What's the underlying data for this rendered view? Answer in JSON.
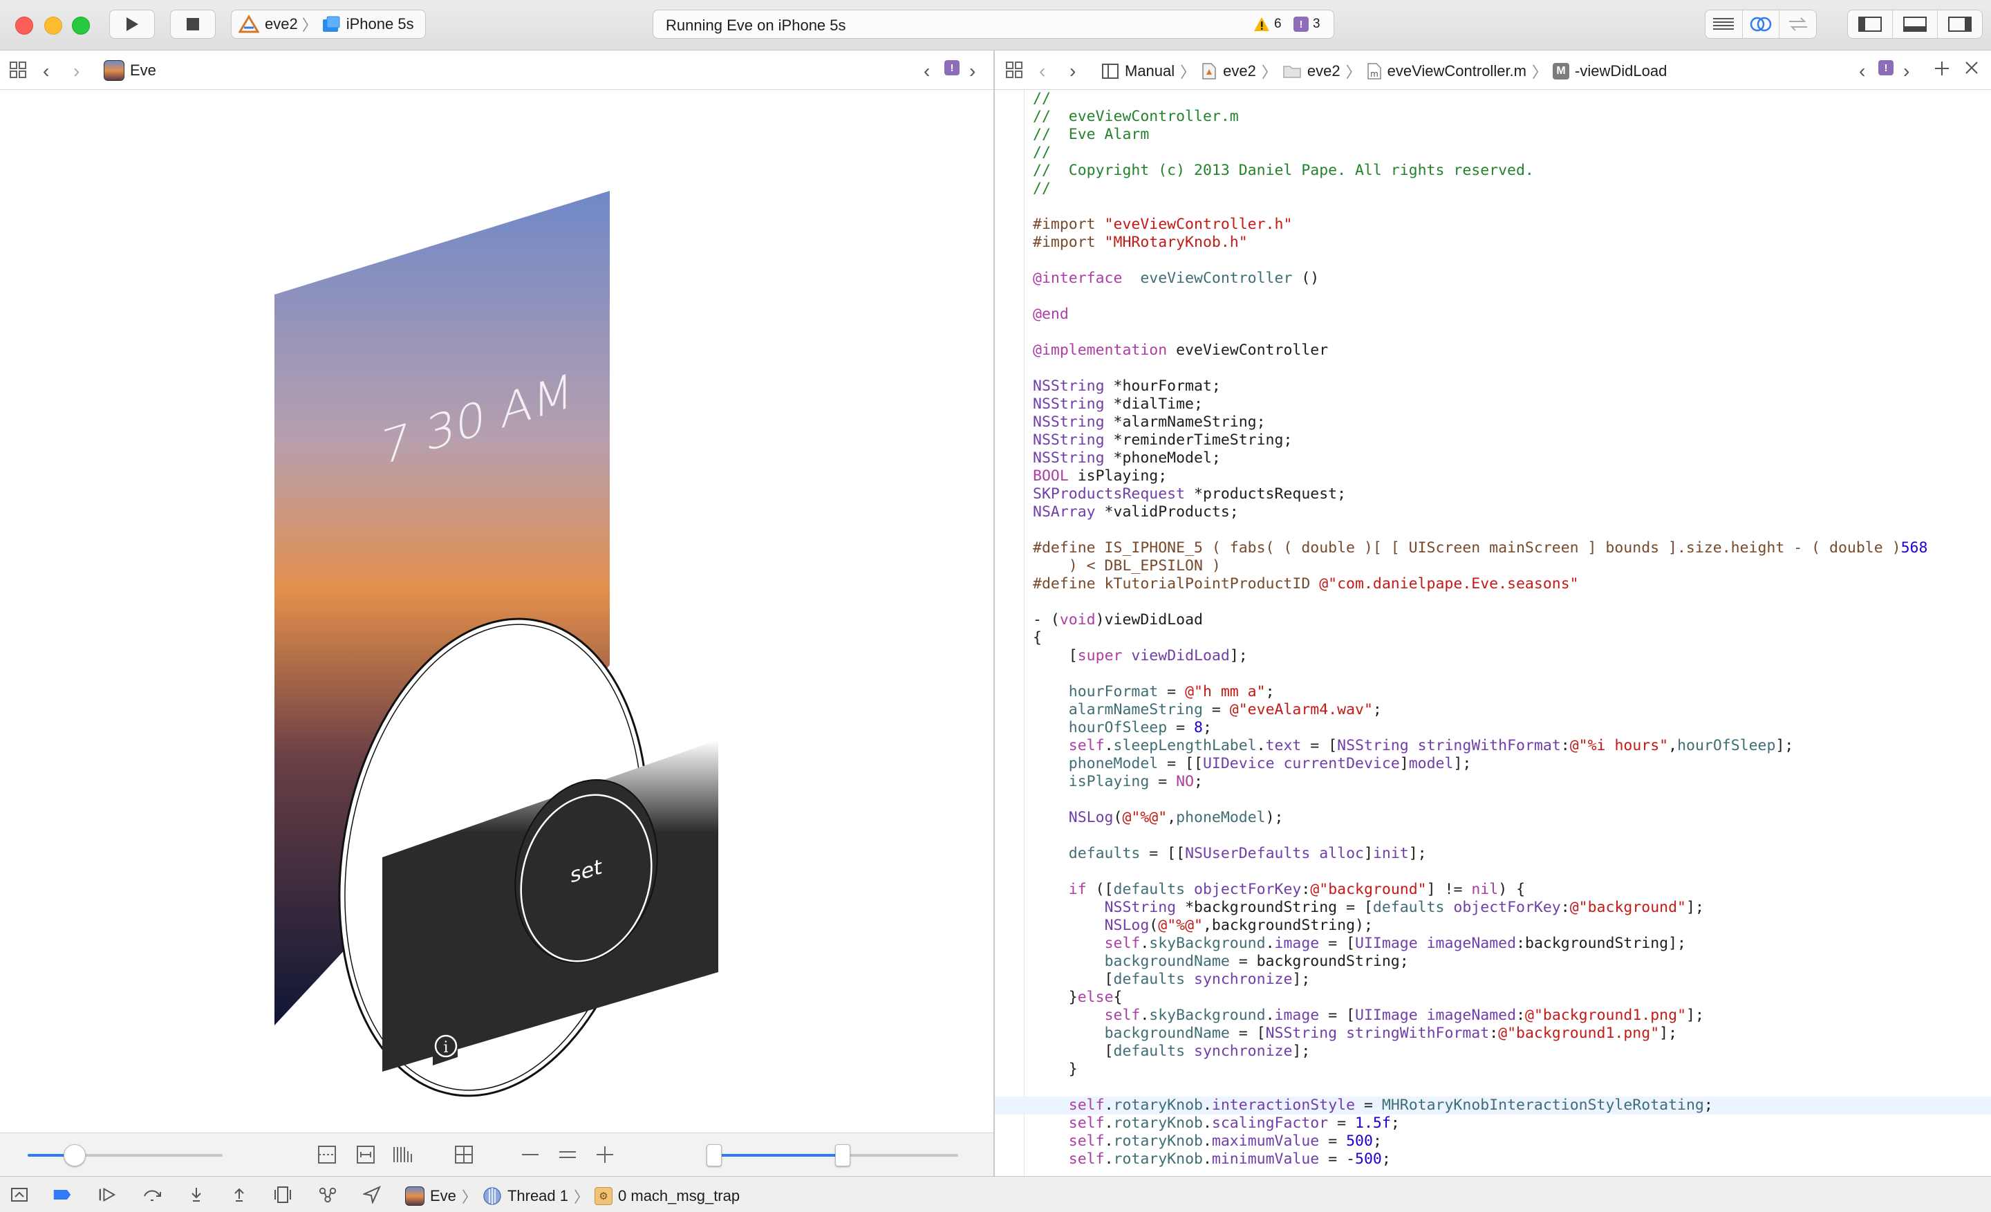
{
  "toolbar": {
    "scheme_target": "eve2",
    "scheme_device": "iPhone 5s",
    "activity_message": "Running Eve on iPhone 5s",
    "warning_count": "6",
    "error_count": "3"
  },
  "left_jumpbar": {
    "app_name": "Eve"
  },
  "right_jumpbar": {
    "crumbs": [
      "Manual",
      "eve2",
      "eve2",
      "eveViewController.m",
      "-viewDidLoad"
    ]
  },
  "scene": {
    "time_label": "7 30 AM",
    "set_label": "set",
    "info_glyph": "i",
    "gradient_colors": [
      "#6f88c8",
      "#e38f4b",
      "#5b3a4a",
      "#0e1735"
    ]
  },
  "debug_bar": {
    "process": "Eve",
    "thread": "Thread 1",
    "frame": "0 mach_msg_trap"
  },
  "editor": {
    "lines": [
      {
        "segs": [
          [
            "c",
            "//"
          ]
        ]
      },
      {
        "segs": [
          [
            "c",
            "//  eveViewController.m"
          ]
        ]
      },
      {
        "segs": [
          [
            "c",
            "//  Eve Alarm"
          ]
        ]
      },
      {
        "segs": [
          [
            "c",
            "//"
          ]
        ]
      },
      {
        "segs": [
          [
            "c",
            "//  Copyright (c) 2013 Daniel Pape. All rights reserved."
          ]
        ]
      },
      {
        "segs": [
          [
            "c",
            "//"
          ]
        ]
      },
      {
        "segs": []
      },
      {
        "segs": [
          [
            "p",
            "#import "
          ],
          [
            "s",
            "\"eveViewController.h\""
          ]
        ]
      },
      {
        "segs": [
          [
            "p",
            "#import "
          ],
          [
            "s",
            "\"MHRotaryKnob.h\""
          ]
        ]
      },
      {
        "segs": []
      },
      {
        "segs": [
          [
            "k",
            "@interface"
          ],
          [
            "",
            "  "
          ],
          [
            "m",
            "eveViewController"
          ],
          [
            "",
            " ()"
          ]
        ]
      },
      {
        "segs": []
      },
      {
        "segs": [
          [
            "k",
            "@end"
          ]
        ]
      },
      {
        "segs": []
      },
      {
        "segs": [
          [
            "k",
            "@implementation"
          ],
          [
            "",
            " eveViewController"
          ]
        ]
      },
      {
        "segs": []
      },
      {
        "segs": [
          [
            "t",
            "NSString"
          ],
          [
            "",
            " *hourFormat;"
          ]
        ]
      },
      {
        "segs": [
          [
            "t",
            "NSString"
          ],
          [
            "",
            " *dialTime;"
          ]
        ]
      },
      {
        "segs": [
          [
            "t",
            "NSString"
          ],
          [
            "",
            " *alarmNameString;"
          ]
        ]
      },
      {
        "segs": [
          [
            "t",
            "NSString"
          ],
          [
            "",
            " *reminderTimeString;"
          ]
        ]
      },
      {
        "segs": [
          [
            "t",
            "NSString"
          ],
          [
            "",
            " *phoneModel;"
          ]
        ]
      },
      {
        "segs": [
          [
            "k",
            "BOOL"
          ],
          [
            "",
            " isPlaying;"
          ]
        ]
      },
      {
        "segs": [
          [
            "t",
            "SKProductsRequest"
          ],
          [
            "",
            " *productsRequest;"
          ]
        ]
      },
      {
        "segs": [
          [
            "t",
            "NSArray"
          ],
          [
            "",
            " *validProducts;"
          ]
        ]
      },
      {
        "segs": []
      },
      {
        "segs": [
          [
            "p",
            "#define IS_IPHONE_5 ( fabs( ( double )[ [ UIScreen mainScreen ] bounds ].size.height - ( double )"
          ],
          [
            "n",
            "568"
          ]
        ]
      },
      {
        "segs": [
          [
            "p",
            "    ) < DBL_EPSILON )"
          ]
        ]
      },
      {
        "segs": [
          [
            "p",
            "#define kTutorialPointProductID "
          ],
          [
            "s",
            "@\"com.danielpape.Eve.seasons\""
          ]
        ]
      },
      {
        "segs": []
      },
      {
        "segs": [
          [
            "",
            "- ("
          ],
          [
            "k",
            "void"
          ],
          [
            "",
            ")viewDidLoad"
          ]
        ]
      },
      {
        "segs": [
          [
            "",
            "{"
          ]
        ]
      },
      {
        "segs": [
          [
            "",
            "    ["
          ],
          [
            "k",
            "super"
          ],
          [
            "",
            " "
          ],
          [
            "t",
            "viewDidLoad"
          ],
          [
            "",
            "];"
          ]
        ]
      },
      {
        "segs": []
      },
      {
        "segs": [
          [
            "",
            "    "
          ],
          [
            "m",
            "hourFormat"
          ],
          [
            "",
            " = "
          ],
          [
            "s",
            "@\"h mm a\""
          ],
          [
            "",
            ";"
          ]
        ]
      },
      {
        "segs": [
          [
            "",
            "    "
          ],
          [
            "m",
            "alarmNameString"
          ],
          [
            "",
            " = "
          ],
          [
            "s",
            "@\"eveAlarm4.wav\""
          ],
          [
            "",
            ";"
          ]
        ]
      },
      {
        "segs": [
          [
            "",
            "    "
          ],
          [
            "m",
            "hourOfSleep"
          ],
          [
            "",
            " = "
          ],
          [
            "n",
            "8"
          ],
          [
            "",
            ";"
          ]
        ]
      },
      {
        "segs": [
          [
            "",
            "    "
          ],
          [
            "k",
            "self"
          ],
          [
            "",
            "."
          ],
          [
            "m",
            "sleepLengthLabel"
          ],
          [
            "",
            "."
          ],
          [
            "t",
            "text"
          ],
          [
            "",
            " = ["
          ],
          [
            "t",
            "NSString"
          ],
          [
            "",
            " "
          ],
          [
            "t",
            "stringWithFormat"
          ],
          [
            "",
            ":"
          ],
          [
            "s",
            "@\"%i hours\""
          ],
          [
            "",
            ","
          ],
          [
            "m",
            "hourOfSleep"
          ],
          [
            "",
            "];"
          ]
        ]
      },
      {
        "segs": [
          [
            "",
            "    "
          ],
          [
            "m",
            "phoneModel"
          ],
          [
            "",
            " = [["
          ],
          [
            "t",
            "UIDevice"
          ],
          [
            "",
            " "
          ],
          [
            "t",
            "currentDevice"
          ],
          [
            "",
            "]"
          ],
          [
            "t",
            "model"
          ],
          [
            "",
            "];"
          ]
        ]
      },
      {
        "segs": [
          [
            "",
            "    "
          ],
          [
            "m",
            "isPlaying"
          ],
          [
            "",
            " = "
          ],
          [
            "k",
            "NO"
          ],
          [
            "",
            ";"
          ]
        ]
      },
      {
        "segs": []
      },
      {
        "segs": [
          [
            "",
            "    "
          ],
          [
            "t",
            "NSLog"
          ],
          [
            "",
            "("
          ],
          [
            "s",
            "@\"%@\""
          ],
          [
            "",
            ","
          ],
          [
            "m",
            "phoneModel"
          ],
          [
            "",
            ");"
          ]
        ]
      },
      {
        "segs": []
      },
      {
        "segs": [
          [
            "",
            "    "
          ],
          [
            "m",
            "defaults"
          ],
          [
            "",
            " = [["
          ],
          [
            "t",
            "NSUserDefaults"
          ],
          [
            "",
            " "
          ],
          [
            "t",
            "alloc"
          ],
          [
            "",
            "]"
          ],
          [
            "t",
            "init"
          ],
          [
            "",
            "];"
          ]
        ]
      },
      {
        "segs": []
      },
      {
        "segs": [
          [
            "",
            "    "
          ],
          [
            "k",
            "if"
          ],
          [
            "",
            " (["
          ],
          [
            "m",
            "defaults"
          ],
          [
            "",
            " "
          ],
          [
            "t",
            "objectForKey"
          ],
          [
            "",
            ":"
          ],
          [
            "s",
            "@\"background\""
          ],
          [
            "",
            "] != "
          ],
          [
            "k",
            "nil"
          ],
          [
            "",
            ") {"
          ]
        ]
      },
      {
        "segs": [
          [
            "",
            "        "
          ],
          [
            "t",
            "NSString"
          ],
          [
            "",
            " *backgroundString = ["
          ],
          [
            "m",
            "defaults"
          ],
          [
            "",
            " "
          ],
          [
            "t",
            "objectForKey"
          ],
          [
            "",
            ":"
          ],
          [
            "s",
            "@\"background\""
          ],
          [
            "",
            "];"
          ]
        ]
      },
      {
        "segs": [
          [
            "",
            "        "
          ],
          [
            "t",
            "NSLog"
          ],
          [
            "",
            "("
          ],
          [
            "s",
            "@\"%@\""
          ],
          [
            "",
            ",backgroundString);"
          ]
        ]
      },
      {
        "segs": [
          [
            "",
            "        "
          ],
          [
            "k",
            "self"
          ],
          [
            "",
            "."
          ],
          [
            "m",
            "skyBackground"
          ],
          [
            "",
            "."
          ],
          [
            "t",
            "image"
          ],
          [
            "",
            " = ["
          ],
          [
            "t",
            "UIImage"
          ],
          [
            "",
            " "
          ],
          [
            "t",
            "imageNamed"
          ],
          [
            "",
            ":backgroundString];"
          ]
        ]
      },
      {
        "segs": [
          [
            "",
            "        "
          ],
          [
            "m",
            "backgroundName"
          ],
          [
            "",
            " = backgroundString;"
          ]
        ]
      },
      {
        "segs": [
          [
            "",
            "        ["
          ],
          [
            "m",
            "defaults"
          ],
          [
            "",
            " "
          ],
          [
            "t",
            "synchronize"
          ],
          [
            "",
            "];"
          ]
        ]
      },
      {
        "segs": [
          [
            "",
            "    }"
          ],
          [
            "k",
            "else"
          ],
          [
            "",
            "{"
          ]
        ]
      },
      {
        "segs": [
          [
            "",
            "        "
          ],
          [
            "k",
            "self"
          ],
          [
            "",
            "."
          ],
          [
            "m",
            "skyBackground"
          ],
          [
            "",
            "."
          ],
          [
            "t",
            "image"
          ],
          [
            "",
            " = ["
          ],
          [
            "t",
            "UIImage"
          ],
          [
            "",
            " "
          ],
          [
            "t",
            "imageNamed"
          ],
          [
            "",
            ":"
          ],
          [
            "s",
            "@\"background1.png\""
          ],
          [
            "",
            "];"
          ]
        ]
      },
      {
        "segs": [
          [
            "",
            "        "
          ],
          [
            "m",
            "backgroundName"
          ],
          [
            "",
            " = ["
          ],
          [
            "t",
            "NSString"
          ],
          [
            "",
            " "
          ],
          [
            "t",
            "stringWithFormat"
          ],
          [
            "",
            ":"
          ],
          [
            "s",
            "@\"background1.png\""
          ],
          [
            "",
            "];"
          ]
        ]
      },
      {
        "segs": [
          [
            "",
            "        ["
          ],
          [
            "m",
            "defaults"
          ],
          [
            "",
            " "
          ],
          [
            "t",
            "synchronize"
          ],
          [
            "",
            "];"
          ]
        ]
      },
      {
        "segs": [
          [
            "",
            "    }"
          ]
        ]
      },
      {
        "segs": []
      },
      {
        "segs": [
          [
            "",
            "    "
          ],
          [
            "k",
            "self"
          ],
          [
            "",
            "."
          ],
          [
            "m",
            "rotaryKnob"
          ],
          [
            "",
            "."
          ],
          [
            "t",
            "interactionStyle"
          ],
          [
            "",
            " = "
          ],
          [
            "m",
            "MHRotaryKnobInteractionStyleRotating"
          ],
          [
            "",
            ";"
          ]
        ],
        "highlight": true
      },
      {
        "segs": [
          [
            "",
            "    "
          ],
          [
            "k",
            "self"
          ],
          [
            "",
            "."
          ],
          [
            "m",
            "rotaryKnob"
          ],
          [
            "",
            "."
          ],
          [
            "t",
            "scalingFactor"
          ],
          [
            "",
            " = "
          ],
          [
            "n",
            "1.5f"
          ],
          [
            "",
            ";"
          ]
        ]
      },
      {
        "segs": [
          [
            "",
            "    "
          ],
          [
            "k",
            "self"
          ],
          [
            "",
            "."
          ],
          [
            "m",
            "rotaryKnob"
          ],
          [
            "",
            "."
          ],
          [
            "t",
            "maximumValue"
          ],
          [
            "",
            " = "
          ],
          [
            "n",
            "500"
          ],
          [
            "",
            ";"
          ]
        ]
      },
      {
        "segs": [
          [
            "",
            "    "
          ],
          [
            "k",
            "self"
          ],
          [
            "",
            "."
          ],
          [
            "m",
            "rotaryKnob"
          ],
          [
            "",
            "."
          ],
          [
            "t",
            "minimumValue"
          ],
          [
            "",
            " = -"
          ],
          [
            "n",
            "500"
          ],
          [
            "",
            ";"
          ]
        ]
      }
    ]
  },
  "colors": {
    "comment": "#23832b",
    "preprocessor": "#78492a",
    "string": "#c41a16",
    "keyword": "#ad3da4",
    "type": "#703daa",
    "project": "#3e6d74",
    "number": "#1c00cf",
    "accent": "#2f7bf5",
    "warning": "#f5b800",
    "issue_badge": "#8e6db8"
  },
  "icons": [
    "run-icon",
    "stop-icon",
    "xcode-project-icon",
    "iphone-device-icon",
    "warning-icon",
    "issue-icon",
    "editor-standard-icon",
    "editor-assistant-icon",
    "editor-version-icon",
    "navigator-toggle-icon",
    "debug-area-toggle-icon",
    "utilities-toggle-icon",
    "related-items-icon",
    "back-icon",
    "forward-icon",
    "add-editor-icon",
    "close-editor-icon",
    "folder-icon",
    "objc-file-icon",
    "method-icon",
    "thread-icon",
    "frame-icon"
  ]
}
